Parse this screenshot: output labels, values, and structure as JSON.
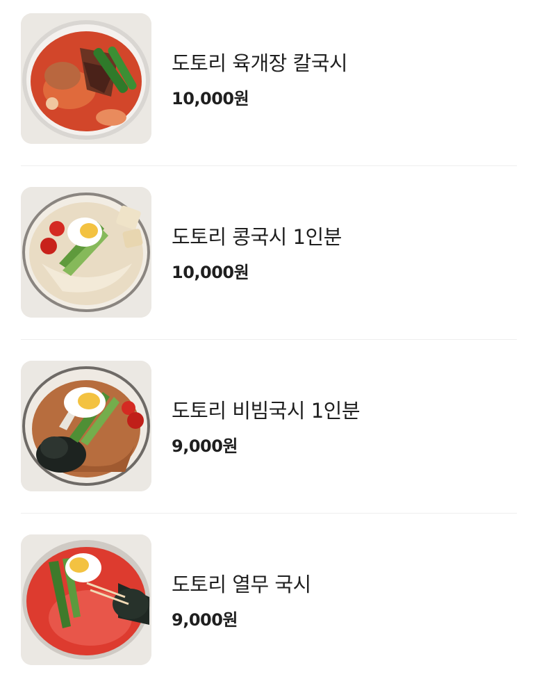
{
  "menu": {
    "items": [
      {
        "name": "도토리 육개장 칼국시",
        "price": "10,000원",
        "image": "spicy-beef-knife-noodle-soup"
      },
      {
        "name": "도토리 콩국시 1인분",
        "price": "10,000원",
        "image": "cold-soy-milk-noodles"
      },
      {
        "name": "도토리 비빔국시 1인분",
        "price": "9,000원",
        "image": "spicy-mixed-noodles"
      },
      {
        "name": "도토리 열무 국시",
        "price": "9,000원",
        "image": "young-radish-kimchi-noodles"
      }
    ]
  },
  "colors": {
    "background": "#ffffff",
    "text": "#1f1f1f",
    "divider": "#eeeeee",
    "thumb_background": "#ece9e4"
  }
}
